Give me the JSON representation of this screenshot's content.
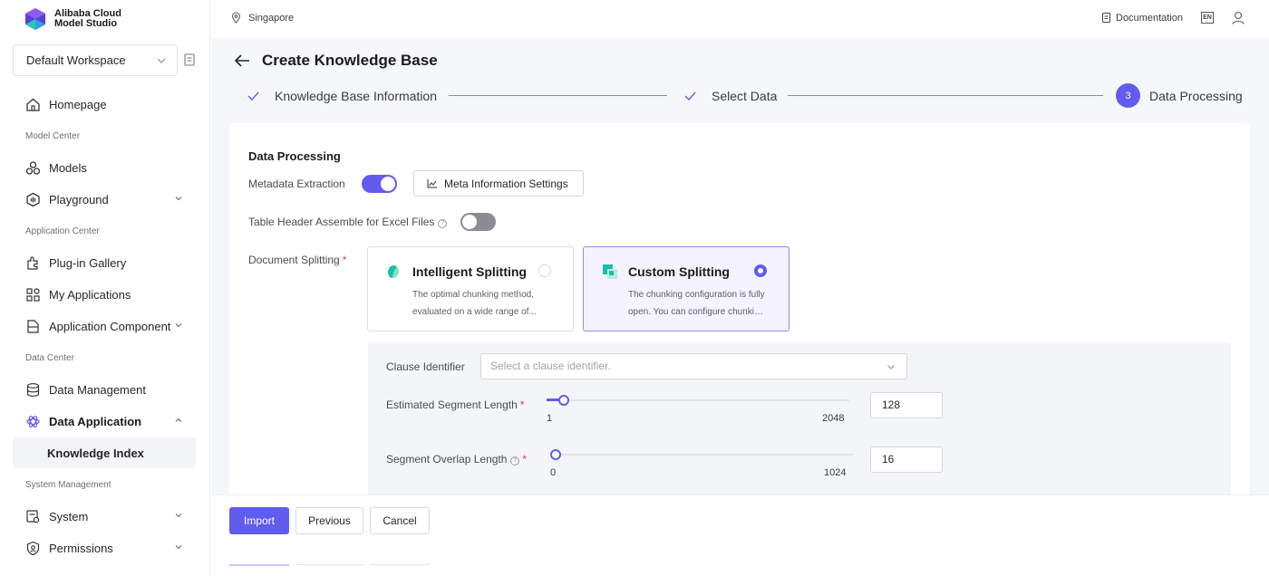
{
  "brand": {
    "line1": "Alibaba Cloud",
    "line2": "Model Studio"
  },
  "workspace": {
    "label": "Default Workspace"
  },
  "sidebar": {
    "items": [
      {
        "label": "Homepage"
      },
      {
        "section": "Model Center"
      },
      {
        "label": "Models"
      },
      {
        "label": "Playground"
      },
      {
        "section": "Application Center"
      },
      {
        "label": "Plug-in Gallery"
      },
      {
        "label": "My Applications"
      },
      {
        "label": "Application Component"
      },
      {
        "section": "Data Center"
      },
      {
        "label": "Data Management"
      },
      {
        "label": "Data Application"
      },
      {
        "label": "Knowledge Index"
      },
      {
        "section": "System Management"
      },
      {
        "label": "System"
      },
      {
        "label": "Permissions"
      }
    ]
  },
  "topbar": {
    "region": "Singapore",
    "documentation": "Documentation",
    "lang": "EN"
  },
  "page": {
    "title": "Create Knowledge Base"
  },
  "steps": [
    {
      "label": "Knowledge Base Information",
      "state": "done"
    },
    {
      "label": "Select Data",
      "state": "done"
    },
    {
      "label": "Data Processing",
      "state": "current",
      "number": "3"
    }
  ],
  "form": {
    "section_title": "Data Processing",
    "metadata_extraction": {
      "label": "Metadata Extraction",
      "on": true
    },
    "meta_settings_button": "Meta Information Settings",
    "table_header": {
      "label": "Table Header Assemble for Excel Files",
      "on": false,
      "help": "?"
    },
    "document_splitting": {
      "label": "Document Splitting",
      "required": "*"
    },
    "options": [
      {
        "name": "Intelligent Splitting",
        "desc1": "The optimal chunking method,",
        "desc2": "evaluated on a wide range of...",
        "selected": false
      },
      {
        "name": "Custom Splitting",
        "desc1": "The chunking configuration is fully",
        "desc2": "open. You can configure chunkin...",
        "selected": true
      }
    ],
    "clause_identifier": {
      "label": "Clause Identifier",
      "placeholder": "Select a clause identifier."
    },
    "segment_length": {
      "label": "Estimated Segment Length",
      "required": "*",
      "min": "1",
      "max": "2048",
      "value": "128"
    },
    "segment_overlap": {
      "label": "Segment Overlap Length",
      "required": "*",
      "help": "?",
      "min": "0",
      "max": "1024",
      "value": "16"
    }
  },
  "footer": {
    "import": "Import",
    "previous": "Previous",
    "cancel": "Cancel"
  },
  "colors": {
    "accent": "#615ced",
    "toggle_off": "#8b8c96"
  }
}
